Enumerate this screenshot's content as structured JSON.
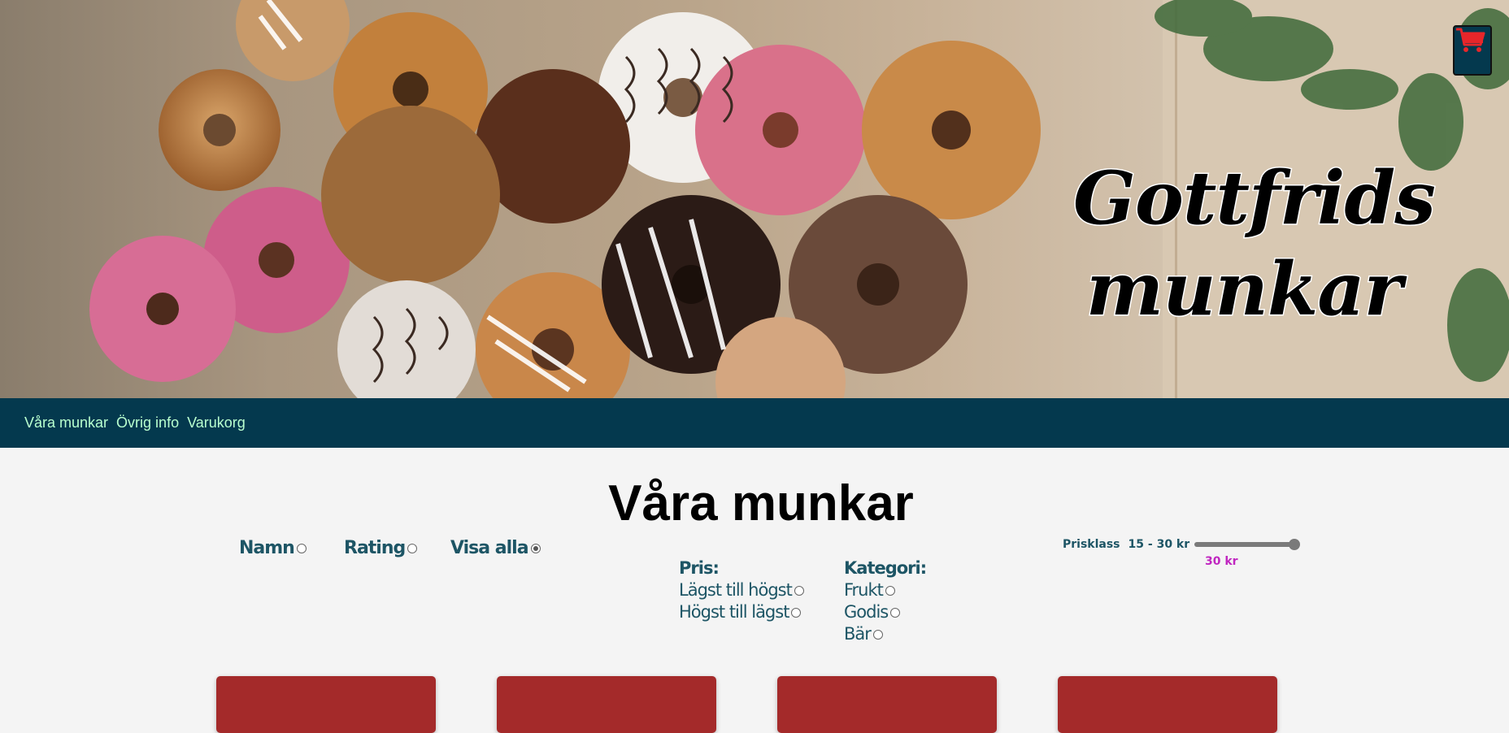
{
  "hero": {
    "title_line1": "Gottfrids",
    "title_line2": "munkar",
    "cart_icon": "shopping-cart-icon",
    "cart_icon_color": "#e8262a",
    "cart_button_color": "#04394e"
  },
  "nav": {
    "background": "#04394e",
    "link_color": "#b9ffcf",
    "items": [
      {
        "label": "Våra munkar"
      },
      {
        "label": "Övrig info"
      },
      {
        "label": "Varukorg"
      }
    ]
  },
  "main": {
    "title": "Våra munkar",
    "sort": [
      {
        "label": "Namn",
        "checked": false
      },
      {
        "label": "Rating",
        "checked": false
      },
      {
        "label": "Visa alla",
        "checked": true
      }
    ],
    "price_filter": {
      "heading": "Pris:",
      "options": [
        {
          "label": "Lägst till högst",
          "checked": false
        },
        {
          "label": "Högst till lägst",
          "checked": false
        }
      ]
    },
    "category_filter": {
      "heading": "Kategori:",
      "options": [
        {
          "label": "Frukt",
          "checked": false
        },
        {
          "label": "Godis",
          "checked": false
        },
        {
          "label": "Bär",
          "checked": false
        }
      ]
    },
    "price_range": {
      "label": "Prisklass",
      "range_text": "15 - 30 kr",
      "min": 15,
      "max": 30,
      "value": 30,
      "value_text": "30 kr",
      "value_color": "#c026c0"
    },
    "card_color": "#a42a2a"
  }
}
